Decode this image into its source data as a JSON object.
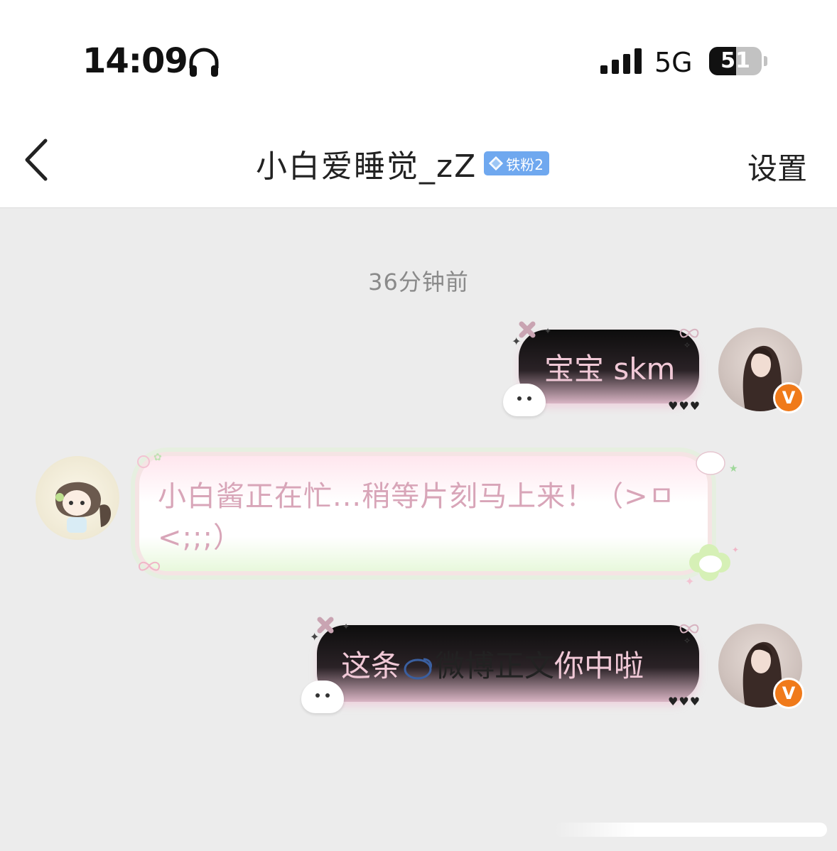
{
  "status_bar": {
    "time": "14:09",
    "network": "5G",
    "battery_percent": "51",
    "battery_level": 0.51,
    "icons": [
      "headphones-icon",
      "signal-bars-icon",
      "battery-icon"
    ]
  },
  "header": {
    "back_icon": "chevron-left-icon",
    "title": "小白爱睡觉_zZ",
    "fan_badge": "铁粉2",
    "settings_label": "设置"
  },
  "chat": {
    "timestamp": "36分钟前",
    "messages": [
      {
        "sender": "self",
        "text": "宝宝 skm"
      },
      {
        "sender": "other",
        "text": "小白酱正在忙...稍等片刻马上来！（>ㅁ<;;;）"
      },
      {
        "sender": "self",
        "text_before": "这条",
        "link_text": "微博正文",
        "text_after": "你中啦"
      }
    ],
    "hearts": "♥♥♥",
    "verified_badge": "V"
  },
  "colors": {
    "background": "#ececec",
    "badge_blue": "#6fa8ef",
    "verified_orange": "#f07a1a",
    "bubble_text_pink": "#d8a5b8"
  }
}
